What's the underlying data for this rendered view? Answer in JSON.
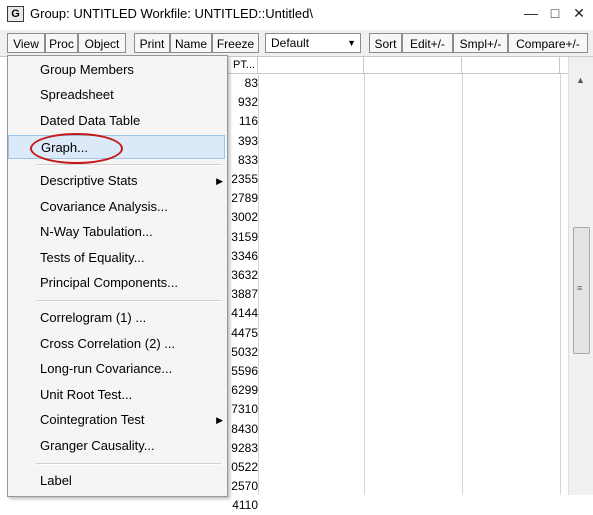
{
  "window": {
    "icon_letter": "G",
    "title": "Group: UNTITLED   Workfile: UNTITLED::Untitled\\",
    "controls": [
      "—",
      "□",
      "✕"
    ]
  },
  "toolbar": {
    "view": "View",
    "proc": "Proc",
    "object": "Object",
    "print": "Print",
    "name": "Name",
    "freeze": "Freeze",
    "default_select": "Default",
    "sort": "Sort",
    "edit": "Edit+/-",
    "smpl": "Smpl+/-",
    "compare": "Compare+/-"
  },
  "grid": {
    "col_header": "PT...",
    "values": [
      "83",
      "932",
      "116",
      "393",
      "833",
      "2355",
      "2789",
      "3002",
      "3159",
      "3346",
      "3632",
      "3887",
      "4144",
      "4475",
      "5032",
      "5596",
      "6299",
      "7310",
      "8430",
      "9283",
      "0522",
      "2570",
      "4110"
    ]
  },
  "menu": {
    "items": [
      {
        "label": "Group Members"
      },
      {
        "label": "Spreadsheet"
      },
      {
        "label": "Dated Data Table"
      },
      {
        "label": "Graph..."
      },
      {
        "label": "Descriptive Stats"
      },
      {
        "label": "Covariance Analysis..."
      },
      {
        "label": "N-Way Tabulation..."
      },
      {
        "label": "Tests of Equality..."
      },
      {
        "label": "Principal Components..."
      },
      {
        "label": "Correlogram (1) ..."
      },
      {
        "label": "Cross Correlation (2) ..."
      },
      {
        "label": "Long-run Covariance..."
      },
      {
        "label": "Unit Root Test..."
      },
      {
        "label": "Cointegration Test"
      },
      {
        "label": "Granger Causality..."
      },
      {
        "label": "Label"
      }
    ]
  },
  "colors": {
    "highlight": "#dbe9f8",
    "annotation_circle": "#c41a1a"
  }
}
